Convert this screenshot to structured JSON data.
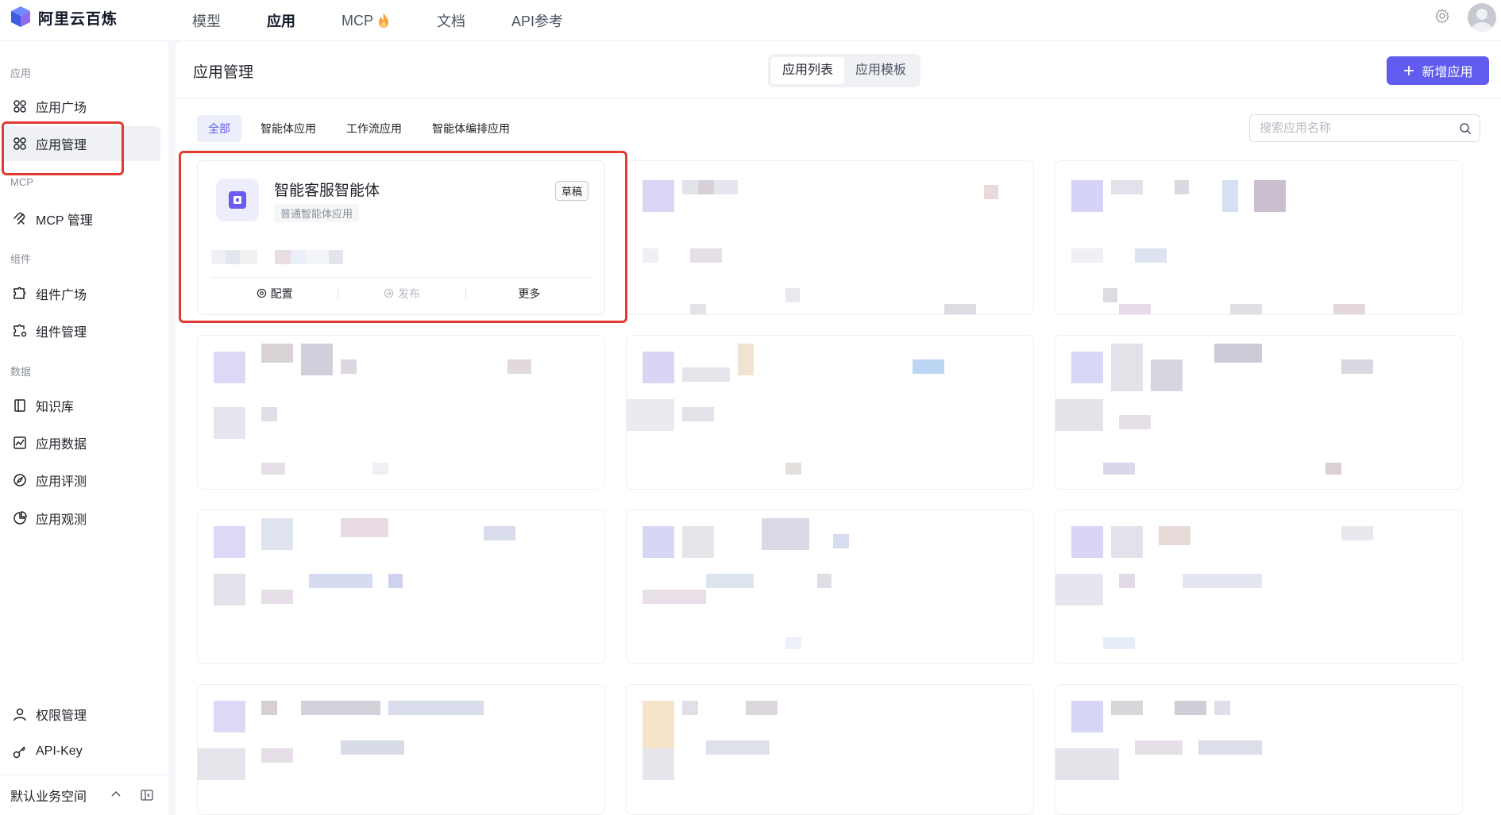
{
  "brand": {
    "name": "阿里云百炼"
  },
  "nav": {
    "items": [
      "模型",
      "应用",
      "MCP",
      "文档",
      "API参考"
    ],
    "active": "应用"
  },
  "sidebar": {
    "sections": {
      "app": "应用",
      "mcp": "MCP",
      "components": "组件",
      "data": "数据"
    },
    "items": {
      "app_plaza": "应用广场",
      "app_manage": "应用管理",
      "mcp_manage": "MCP 管理",
      "comp_plaza": "组件广场",
      "comp_manage": "组件管理",
      "knowledge": "知识库",
      "app_data": "应用数据",
      "app_eval": "应用评测",
      "app_observe": "应用观测",
      "permissions": "权限管理",
      "api_key": "API-Key"
    },
    "workspace": "默认业务空间"
  },
  "main": {
    "title": "应用管理",
    "tabs": [
      "应用列表",
      "应用模板"
    ],
    "add_button": "新增应用",
    "filters": [
      "全部",
      "智能体应用",
      "工作流应用",
      "智能体编排应用"
    ],
    "search_placeholder": "搜索应用名称"
  },
  "card": {
    "title": "智能客服智能体",
    "subtitle": "普通智能体应用",
    "badge": "草稿",
    "actions": {
      "configure": "配置",
      "publish": "发布",
      "more": "更多"
    }
  },
  "colors": {
    "accent": "#615ced",
    "highlight": "#e23b31"
  }
}
